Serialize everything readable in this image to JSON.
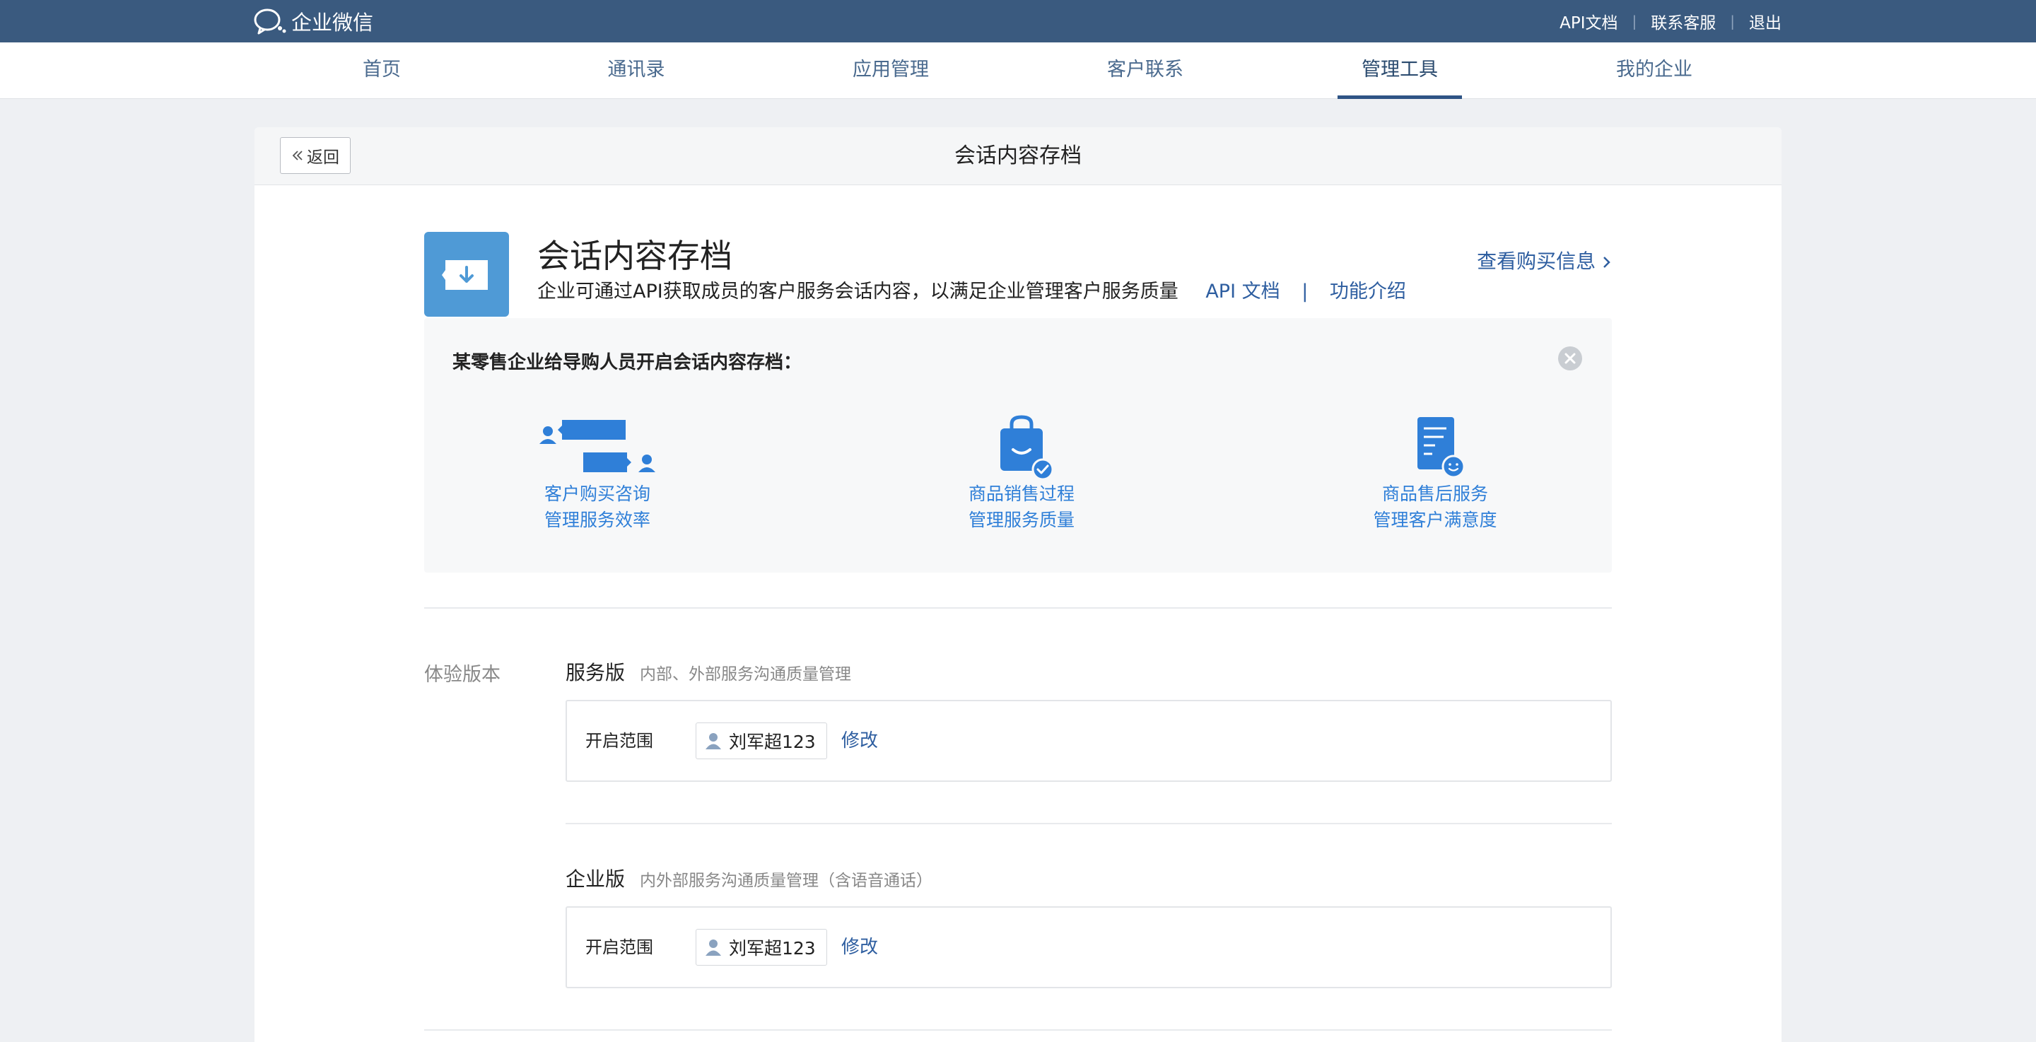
{
  "topbar": {
    "logo_text": "企业微信",
    "links": [
      "API文档",
      "联系客服",
      "退出"
    ]
  },
  "nav": {
    "items": [
      "首页",
      "通讯录",
      "应用管理",
      "客户联系",
      "管理工具",
      "我的企业"
    ],
    "active": "管理工具"
  },
  "page": {
    "back_label": "返回",
    "title": "会话内容存档"
  },
  "app": {
    "name": "会话内容存档",
    "description": "企业可通过API获取成员的客户服务会话内容，以满足企业管理客户服务质量",
    "link_api": "API 文档",
    "link_separator": "|",
    "link_intro": "功能介绍",
    "purchase_link": "查看购买信息"
  },
  "example": {
    "title": "某零售企业给导购人员开启会话内容存档：",
    "features": [
      {
        "icon": "chat-bubbles-icon",
        "line1": "客户购买咨询",
        "line2": "管理服务效率"
      },
      {
        "icon": "shopping-bag-icon",
        "line1": "商品销售过程",
        "line2": "管理服务质量"
      },
      {
        "icon": "document-smile-icon",
        "line1": "商品售后服务",
        "line2": "管理客户满意度"
      }
    ]
  },
  "trial": {
    "label": "体验版本",
    "editions": [
      {
        "name": "服务版",
        "desc": "内部、外部服务沟通质量管理",
        "scope_label": "开启范围",
        "member": "刘军超123",
        "modify_label": "修改"
      },
      {
        "name": "企业版",
        "desc": "内外部服务沟通质量管理（含语音通话）",
        "scope_label": "开启范围",
        "member": "刘军超123",
        "modify_label": "修改"
      }
    ]
  },
  "colors": {
    "topbar": "#3a5a7f",
    "link": "#2e5ea0",
    "feature_blue": "#2f7fd8",
    "app_icon": "#4f9ad6"
  }
}
